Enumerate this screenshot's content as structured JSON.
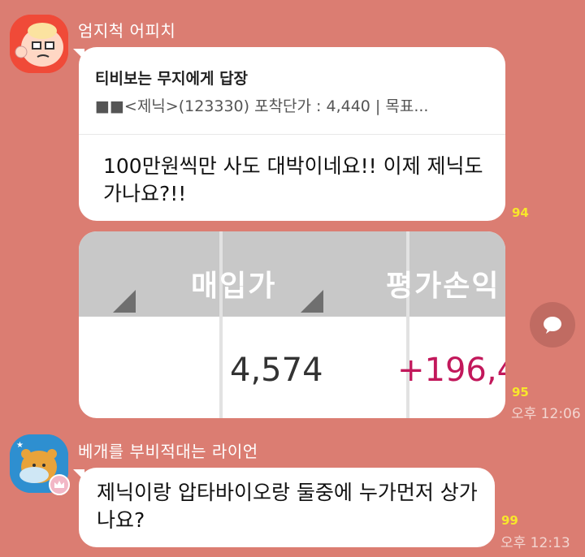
{
  "messages": [
    {
      "sender": "엄지척 어피치",
      "reply": {
        "title": "티비보는 무지에게 답장",
        "preview": "■■<제닉>(123330) 포착단가 : 4,440 | 목표..."
      },
      "text": "100만원씩만 사도 대박이네요!! 이제 제닉도 가나요?!!",
      "unread": "94"
    },
    {
      "image": {
        "headers": [
          "매입가",
          "평가손익"
        ],
        "values": [
          "4,574",
          "+196,4"
        ]
      },
      "unread": "95",
      "time": "오후 12:06"
    },
    {
      "sender": "베개를 부비적대는 라이언",
      "text": "제닉이랑 압타바이오랑 둘중에 누가먼저 상가나요?",
      "unread": "99",
      "time": "오후 12:13"
    }
  ],
  "colors": {
    "background": "#db7d72",
    "bubble": "#ffffff",
    "unread": "#f8e72b",
    "profit": "#c2185b"
  },
  "icons": {
    "share": "share-speech-icon",
    "crown": "crown-icon"
  }
}
